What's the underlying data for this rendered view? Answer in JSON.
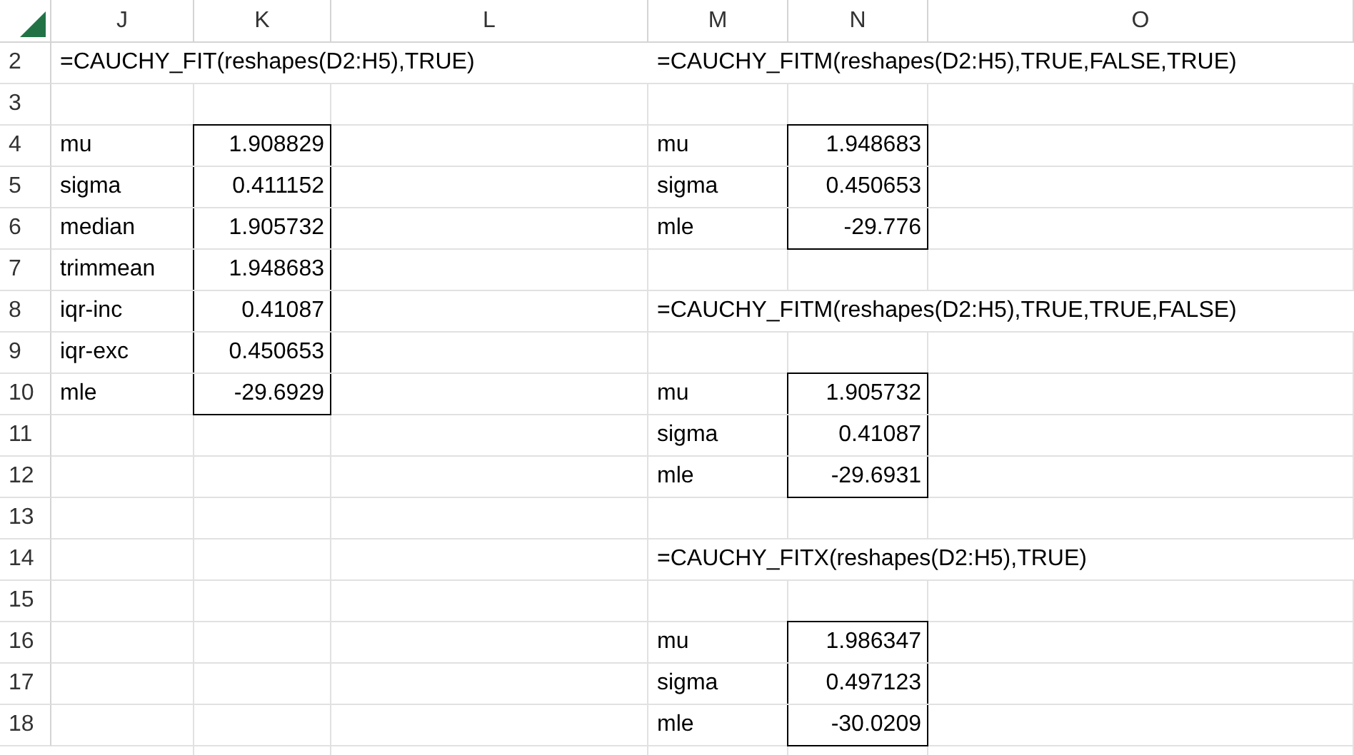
{
  "column_headers": [
    "J",
    "K",
    "L",
    "M",
    "N",
    "O"
  ],
  "rows": [
    {
      "number": "2",
      "cells": [
        {
          "text": "=CAUCHY_FIT(reshapes(D2:H5),TRUE)",
          "kind": "formula"
        },
        null,
        null,
        {
          "text": "=CAUCHY_FITM(reshapes(D2:H5),TRUE,FALSE,TRUE)",
          "kind": "formula"
        },
        null,
        null
      ]
    },
    {
      "number": "3",
      "cells": [
        null,
        null,
        null,
        null,
        null,
        null
      ]
    },
    {
      "number": "4",
      "cells": [
        {
          "text": "mu",
          "kind": "label"
        },
        {
          "text": "1.908829",
          "kind": "number",
          "boxed": true
        },
        null,
        {
          "text": "mu",
          "kind": "label"
        },
        {
          "text": "1.948683",
          "kind": "number",
          "boxed": true
        },
        null
      ]
    },
    {
      "number": "5",
      "cells": [
        {
          "text": "sigma",
          "kind": "label"
        },
        {
          "text": "0.411152",
          "kind": "number",
          "boxed": true
        },
        null,
        {
          "text": "sigma",
          "kind": "label"
        },
        {
          "text": "0.450653",
          "kind": "number",
          "boxed": true
        },
        null
      ]
    },
    {
      "number": "6",
      "cells": [
        {
          "text": "median",
          "kind": "label"
        },
        {
          "text": "1.905732",
          "kind": "number",
          "boxed": true
        },
        null,
        {
          "text": "mle",
          "kind": "label"
        },
        {
          "text": "-29.776",
          "kind": "number",
          "boxed": true
        },
        null
      ]
    },
    {
      "number": "7",
      "cells": [
        {
          "text": "trimmean",
          "kind": "label"
        },
        {
          "text": "1.948683",
          "kind": "number",
          "boxed": true
        },
        null,
        null,
        null,
        null
      ]
    },
    {
      "number": "8",
      "cells": [
        {
          "text": "iqr-inc",
          "kind": "label"
        },
        {
          "text": "0.41087",
          "kind": "number",
          "boxed": true
        },
        null,
        {
          "text": "=CAUCHY_FITM(reshapes(D2:H5),TRUE,TRUE,FALSE)",
          "kind": "formula"
        },
        null,
        null
      ]
    },
    {
      "number": "9",
      "cells": [
        {
          "text": "iqr-exc",
          "kind": "label"
        },
        {
          "text": "0.450653",
          "kind": "number",
          "boxed": true
        },
        null,
        null,
        null,
        null
      ]
    },
    {
      "number": "10",
      "cells": [
        {
          "text": "mle",
          "kind": "label"
        },
        {
          "text": "-29.6929",
          "kind": "number",
          "boxed": true
        },
        null,
        {
          "text": "mu",
          "kind": "label"
        },
        {
          "text": "1.905732",
          "kind": "number",
          "boxed": true
        },
        null
      ]
    },
    {
      "number": "11",
      "cells": [
        null,
        null,
        null,
        {
          "text": "sigma",
          "kind": "label"
        },
        {
          "text": "0.41087",
          "kind": "number",
          "boxed": true
        },
        null
      ]
    },
    {
      "number": "12",
      "cells": [
        null,
        null,
        null,
        {
          "text": "mle",
          "kind": "label"
        },
        {
          "text": "-29.6931",
          "kind": "number",
          "boxed": true
        },
        null
      ]
    },
    {
      "number": "13",
      "cells": [
        null,
        null,
        null,
        null,
        null,
        null
      ]
    },
    {
      "number": "14",
      "cells": [
        null,
        null,
        null,
        {
          "text": "=CAUCHY_FITX(reshapes(D2:H5),TRUE)",
          "kind": "formula"
        },
        null,
        null
      ]
    },
    {
      "number": "15",
      "cells": [
        null,
        null,
        null,
        null,
        null,
        null
      ]
    },
    {
      "number": "16",
      "cells": [
        null,
        null,
        null,
        {
          "text": "mu",
          "kind": "label"
        },
        {
          "text": "1.986347",
          "kind": "number",
          "boxed": true
        },
        null
      ]
    },
    {
      "number": "17",
      "cells": [
        null,
        null,
        null,
        {
          "text": "sigma",
          "kind": "label"
        },
        {
          "text": "0.497123",
          "kind": "number",
          "boxed": true
        },
        null
      ]
    },
    {
      "number": "18",
      "cells": [
        null,
        null,
        null,
        {
          "text": "mle",
          "kind": "label"
        },
        {
          "text": "-30.0209",
          "kind": "number",
          "boxed": true
        },
        null
      ]
    }
  ]
}
